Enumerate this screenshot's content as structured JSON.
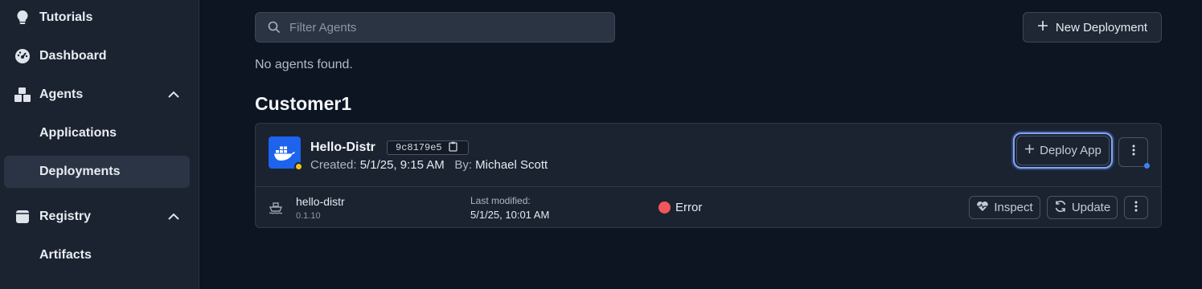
{
  "sidebar": {
    "items": [
      {
        "label": "Tutorials",
        "icon": "lightbulb-icon"
      },
      {
        "label": "Dashboard",
        "icon": "gauge-icon"
      },
      {
        "label": "Agents",
        "icon": "boxes-icon",
        "expanded": true
      },
      {
        "label": "Applications"
      },
      {
        "label": "Deployments",
        "active": true
      },
      {
        "label": "Registry",
        "icon": "database-icon",
        "expanded": true
      },
      {
        "label": "Artifacts"
      }
    ]
  },
  "toolbar": {
    "search_placeholder": "Filter Agents",
    "new_deployment_label": "New Deployment"
  },
  "empty_message": "No agents found.",
  "group": {
    "title": "Customer1",
    "agent": {
      "name": "Hello-Distr",
      "hash": "9c8179e5",
      "created_label": "Created:",
      "created_value": "5/1/25, 9:15 AM",
      "by_label": "By:",
      "by_value": "Michael Scott",
      "status_color": "#f5c518",
      "deploy_app_label": "Deploy App"
    },
    "deployment": {
      "app_name": "hello-distr",
      "version": "0.1.10",
      "last_modified_label": "Last modified:",
      "last_modified_value": "5/1/25, 10:01 AM",
      "status": "Error",
      "status_color": "#f0565b",
      "inspect_label": "Inspect",
      "update_label": "Update"
    }
  },
  "colors": {
    "background": "#0d1422",
    "sidebar": "#1b2331",
    "accent": "#3b82f6",
    "docker_blue": "#1d63ed"
  }
}
